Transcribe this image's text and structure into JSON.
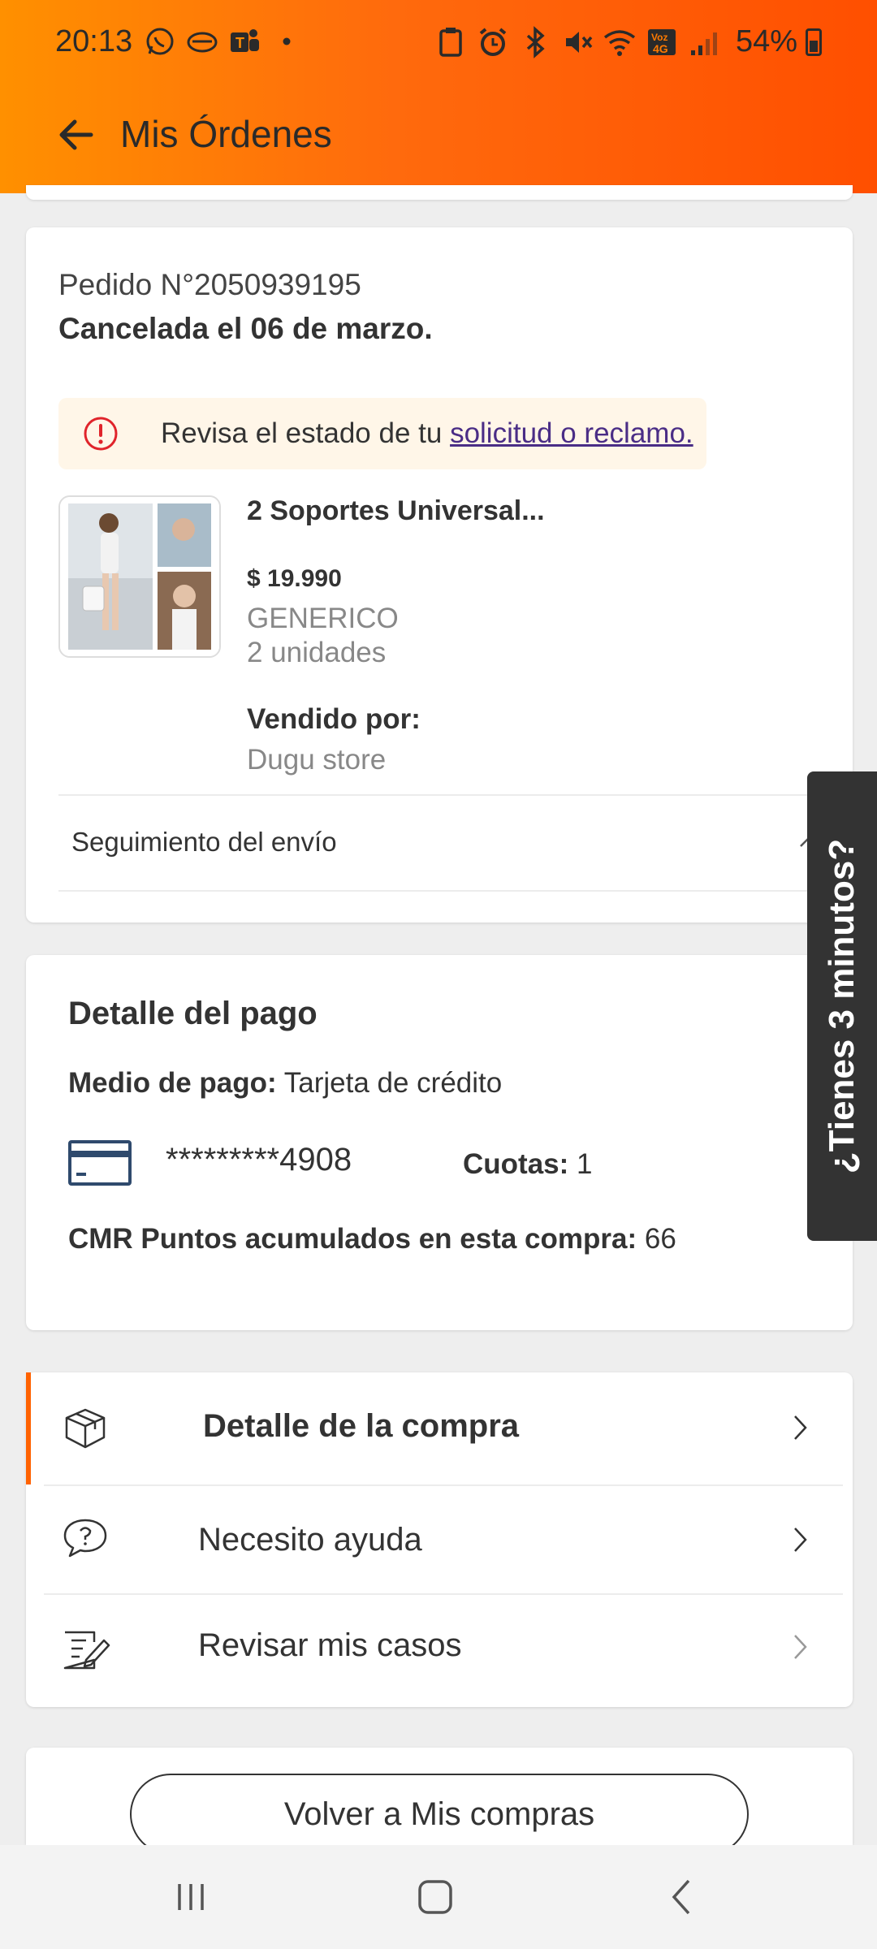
{
  "status_bar": {
    "time": "20:13",
    "battery": "54%",
    "left_icons": [
      "whatsapp-icon",
      "handshake-icon",
      "teams-icon",
      "dot-icon"
    ],
    "right_icons": [
      "clipboard-icon",
      "alarm-icon",
      "bluetooth-icon",
      "mute-icon",
      "wifi-icon",
      "volte-icon",
      "signal-icon"
    ]
  },
  "header": {
    "title": "Mis Órdenes"
  },
  "order": {
    "number": "Pedido N°2050939195",
    "status": "Cancelada el 06 de marzo.",
    "alert_text": "Revisa el estado de tu ",
    "alert_link": "solicitud o reclamo.",
    "product": {
      "name": "2 Soportes Universal...",
      "price": "$ 19.990",
      "brand": "GENERICO",
      "units": "2 unidades",
      "sold_by_label": "Vendido por:",
      "sold_by_value": "Dugu store"
    },
    "tracking_label": "Seguimiento del envío"
  },
  "payment": {
    "title": "Detalle del pago",
    "method_label": "Medio de pago:",
    "method_value": " Tarjeta de crédito",
    "card_number": "*********4908",
    "cuotas_label": "Cuotas:",
    "cuotas_value": " 1",
    "points_label": "CMR Puntos acumulados en esta compra:",
    "points_value": " 66"
  },
  "menu": {
    "items": [
      {
        "label": "Detalle de la compra",
        "icon": "box-icon"
      },
      {
        "label": "Necesito ayuda",
        "icon": "help-chat-icon"
      },
      {
        "label": "Revisar mis casos",
        "icon": "notes-edit-icon"
      }
    ]
  },
  "footer": {
    "back_button": "Volver a Mis compras"
  },
  "survey_tab": {
    "label": "¿Tienes 3 minutos?"
  },
  "colors": {
    "header_start": "#ff9000",
    "header_end": "#ff4f00",
    "accent": "#ff6200",
    "link": "#4a2d86",
    "alert_bg": "#fff6e8",
    "survey_bg": "#333333"
  }
}
